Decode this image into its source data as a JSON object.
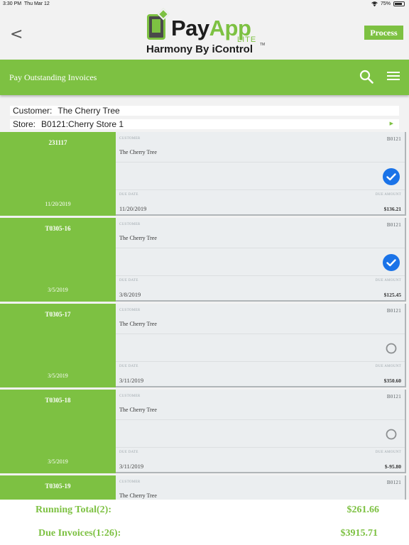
{
  "status_bar": {
    "time": "3:30 PM",
    "date": "Thu Mar 12",
    "battery": "75%"
  },
  "header": {
    "back_label": "<",
    "logo_title_pay": "Pay",
    "logo_title_app": "App",
    "logo_lite": "LITE",
    "logo_subtitle": "Harmony By iControl",
    "logo_tm": "TM",
    "process_label": "Process"
  },
  "navbar": {
    "title": "Pay Outstanding Invoices"
  },
  "customer_field": {
    "label": "Customer:",
    "value": "The Cherry Tree"
  },
  "store_field": {
    "label": "Store:",
    "value": "B0121:Cherry Store 1"
  },
  "list_labels": {
    "customer": "CUSTOMER",
    "due_date": "DUE DATE",
    "due_amount": "DUE AMOUNT"
  },
  "invoices": [
    {
      "number": "231117",
      "date_left": "11/20/2019",
      "store": "B0121",
      "customer": "The Cherry Tree",
      "due_date": "11/20/2019",
      "due_amount": "$136.21",
      "selected": true
    },
    {
      "number": "T0305-16",
      "date_left": "3/5/2019",
      "store": "B0121",
      "customer": "The Cherry Tree",
      "due_date": "3/8/2019",
      "due_amount": "$125.45",
      "selected": true
    },
    {
      "number": "T0305-17",
      "date_left": "3/5/2019",
      "store": "B0121",
      "customer": "The Cherry Tree",
      "due_date": "3/11/2019",
      "due_amount": "$350.60",
      "selected": false
    },
    {
      "number": "T0305-18",
      "date_left": "3/5/2019",
      "store": "B0121",
      "customer": "The Cherry Tree",
      "due_date": "3/11/2019",
      "due_amount": "$-95.80",
      "selected": false
    },
    {
      "number": "T0305-19",
      "date_left": "",
      "store": "B0121",
      "customer": "The Cherry Tree",
      "due_date": "",
      "due_amount": "",
      "selected": false
    }
  ],
  "totals": {
    "running_label": "Running Total(2):",
    "running_value": "$261.66",
    "due_label": "Due Invoices(1:26):",
    "due_value": "$3915.71"
  },
  "colors": {
    "accent": "#7dc142",
    "selected_check": "#1a73e8"
  }
}
